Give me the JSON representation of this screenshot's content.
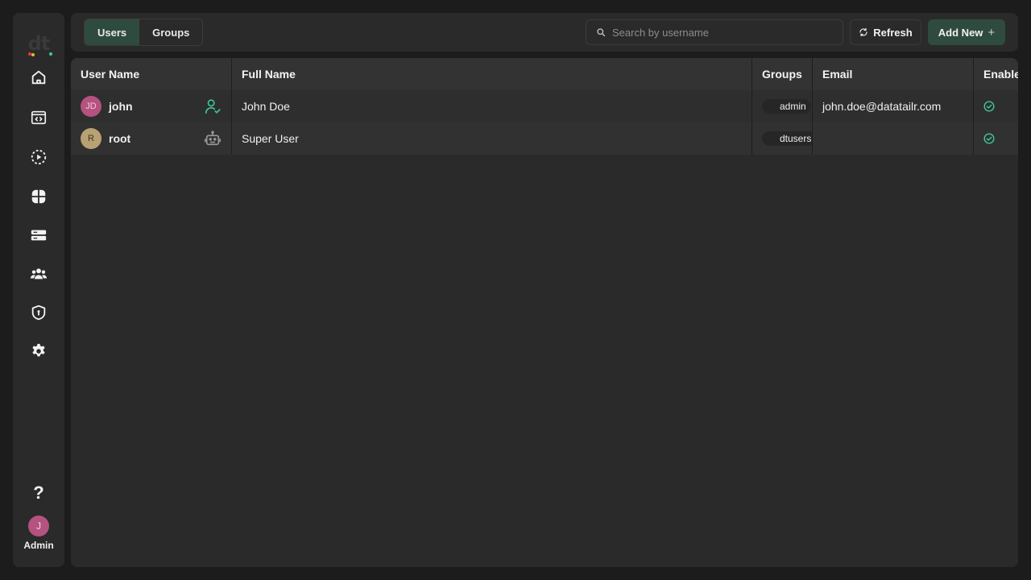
{
  "app": {
    "logo_text": "dt",
    "user": {
      "initial": "J",
      "label": "Admin",
      "color": "#b5527f"
    }
  },
  "sidebar": {
    "items": [
      {
        "name": "home",
        "icon": "home-icon"
      },
      {
        "name": "code",
        "icon": "code-window-icon"
      },
      {
        "name": "jobs",
        "icon": "play-circle-icon"
      },
      {
        "name": "apps",
        "icon": "grid-petals-icon"
      },
      {
        "name": "servers",
        "icon": "server-icon"
      },
      {
        "name": "users",
        "icon": "users-icon"
      },
      {
        "name": "security",
        "icon": "shield-icon"
      },
      {
        "name": "settings",
        "icon": "gear-icon"
      }
    ],
    "help_label": "?"
  },
  "toolbar": {
    "tabs": [
      {
        "label": "Users",
        "active": true
      },
      {
        "label": "Groups",
        "active": false
      }
    ],
    "search_placeholder": "Search by username",
    "search_value": "",
    "refresh_label": "Refresh",
    "add_label": "Add New"
  },
  "table": {
    "columns": [
      "User Name",
      "Full Name",
      "Groups",
      "Email",
      "Enable"
    ],
    "rows": [
      {
        "initials": "JD",
        "avatar_color": "#b5527f",
        "avatar_text_color": "#f2c7db",
        "username": "john",
        "type_icon": "user-check-icon",
        "full_name": "John Doe",
        "group": "admin",
        "email": "john.doe@datatailr.com",
        "enabled": true
      },
      {
        "initials": "R",
        "avatar_color": "#b8a172",
        "avatar_text_color": "#3a3120",
        "username": "root",
        "type_icon": "robot-icon",
        "full_name": "Super User",
        "group": "dtusers",
        "email": "",
        "enabled": true
      }
    ]
  },
  "colors": {
    "accent": "#2f4b40",
    "success": "#3fc79a",
    "bg": "#1c1c1c",
    "panel": "#2a2a2a"
  }
}
